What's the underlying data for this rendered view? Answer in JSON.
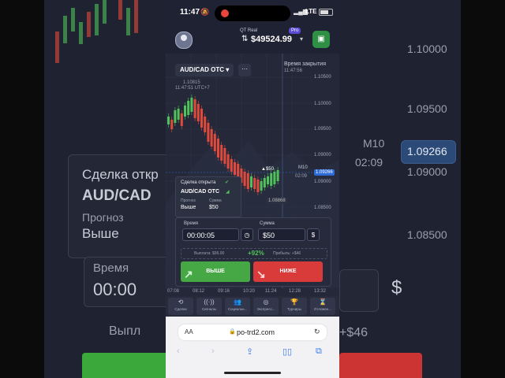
{
  "status_bar": {
    "time": "11:47",
    "network": "LTE"
  },
  "header": {
    "account_label": "QT Real",
    "pro_badge": "Pro",
    "balance": "$49524.99"
  },
  "chart": {
    "pair": "AUD/CAD OTC",
    "more": "···",
    "close_label": "Время закрытия",
    "close_time": "11:47:56",
    "cursor_price": "1.10815",
    "cursor_time": "11:47:51",
    "cursor_tz": "UTC+7",
    "price_ticks": [
      "1.11000",
      "1.10500",
      "1.10000",
      "1.09500",
      "1.09000",
      "1.08500"
    ],
    "current_price": "1.09266",
    "timeframe": "M10",
    "countdown": "02:09",
    "low_label": "1.08868",
    "trade_marker": "$50",
    "time_ticks": [
      "07:08",
      "08:12",
      "09:16",
      "10:20",
      "11:24",
      "12:28",
      "13:32"
    ],
    "colors": {
      "up": "#4fc35a",
      "down": "#e04a3c",
      "price_tag": "#2f6bd6"
    }
  },
  "deal": {
    "title": "Сделка открыта",
    "pair": "AUD/CAD OTC",
    "forecast_label": "Прогноз",
    "forecast_value": "Выше",
    "amount_label": "Сумма",
    "amount_value": "$50"
  },
  "order": {
    "time_label": "Время",
    "time_value": "00:00:05",
    "amount_label": "Сумма",
    "amount_value": "$50",
    "payout_text": "Выплата: $96.00",
    "payout_percent": "+92%",
    "profit_text": "Прибыль: +$46",
    "buy_label": "ВЫШЕ",
    "sell_label": "НИЖЕ"
  },
  "nav": [
    {
      "icon": "history-icon",
      "glyph": "⟲",
      "label": "Сделки"
    },
    {
      "icon": "signals-icon",
      "glyph": "((·))",
      "label": "Сигналы"
    },
    {
      "icon": "social-icon",
      "glyph": "👥",
      "label": "Социальн..."
    },
    {
      "icon": "express-icon",
      "glyph": "◎",
      "label": "Экспресс..."
    },
    {
      "icon": "trophy-icon",
      "glyph": "🏆",
      "label": "Турниры"
    },
    {
      "icon": "pending-icon",
      "glyph": "⌛",
      "label": "Отложен..."
    }
  ],
  "browser": {
    "aa": "AA",
    "url": "po-trd2.com"
  },
  "background": {
    "title": "Сделка откр",
    "pair": "AUD/CAD",
    "forecast_label": "Прогноз",
    "forecast_value": "Выше",
    "time_label": "Время",
    "time_value": "00:00",
    "payout_fragment": "Выпл",
    "right_prices": [
      "1.10000",
      "1.09500",
      "1.09266",
      "1.09000",
      "1.08500"
    ],
    "right_tf": "M10",
    "right_timer": "02:09",
    "right_profit": "+$46",
    "right_dollar": "$"
  }
}
